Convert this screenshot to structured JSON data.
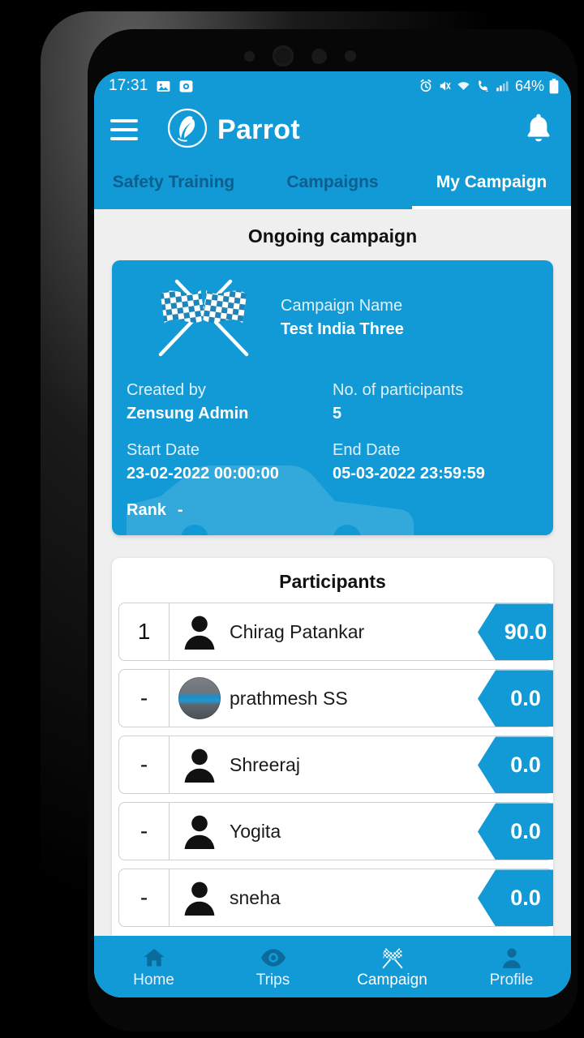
{
  "colors": {
    "brand_blue": "#119AD6",
    "tab_inactive_text": "#0B5E8D",
    "screen_bg": "#EFEFEF",
    "nav_icon_inactive": "#0B6C9B",
    "nav_icon_active": "#FFFFFF"
  },
  "status_bar": {
    "time": "17:31",
    "icons_left": [
      "image-icon",
      "camera-app-icon"
    ],
    "icons_right": [
      "alarm-icon",
      "vibrate-mute-icon",
      "wifi-icon",
      "wifi-calling-icon",
      "signal-bars-icon"
    ],
    "battery_percent": "64%"
  },
  "app_bar": {
    "menu_icon": "hamburger-menu-icon",
    "brand_logo": "parrot-logo-icon",
    "brand_name": "Parrot",
    "notification_icon": "bell-icon"
  },
  "tabs": [
    {
      "label": "Safety Training",
      "active": false
    },
    {
      "label": "Campaigns",
      "active": false
    },
    {
      "label": "My Campaign",
      "active": true
    }
  ],
  "main": {
    "section_title": "Ongoing campaign",
    "campaign_card": {
      "flag_icon": "checkered-flags-icon",
      "watermark_icon": "car-watermark-icon",
      "fields": {
        "campaign_name_label": "Campaign Name",
        "campaign_name_value": "Test India Three",
        "created_by_label": "Created by",
        "created_by_value": "Zensung Admin",
        "participants_label": "No. of participants",
        "participants_value": "5",
        "start_date_label": "Start Date",
        "start_date_value": "23-02-2022 00:00:00",
        "end_date_label": "End Date",
        "end_date_value": "05-03-2022 23:59:59",
        "rank_label": "Rank",
        "rank_value": "-"
      }
    },
    "participants": {
      "title": "Participants",
      "rows": [
        {
          "rank": "1",
          "name": "Chirag Patankar",
          "score": "90.0",
          "avatar": "person-silhouette-icon"
        },
        {
          "rank": "-",
          "name": "prathmesh SS",
          "score": "0.0",
          "avatar": "profile-photo"
        },
        {
          "rank": "-",
          "name": "Shreeraj",
          "score": "0.0",
          "avatar": "person-silhouette-icon"
        },
        {
          "rank": "-",
          "name": "Yogita",
          "score": "0.0",
          "avatar": "person-silhouette-icon"
        },
        {
          "rank": "-",
          "name": "sneha",
          "score": "0.0",
          "avatar": "person-silhouette-icon"
        }
      ]
    }
  },
  "bottom_nav": [
    {
      "label": "Home",
      "icon": "home-icon",
      "active": false
    },
    {
      "label": "Trips",
      "icon": "eye-icon",
      "active": false
    },
    {
      "label": "Campaign",
      "icon": "checkered-flags-icon",
      "active": true
    },
    {
      "label": "Profile",
      "icon": "person-icon",
      "active": false
    }
  ]
}
